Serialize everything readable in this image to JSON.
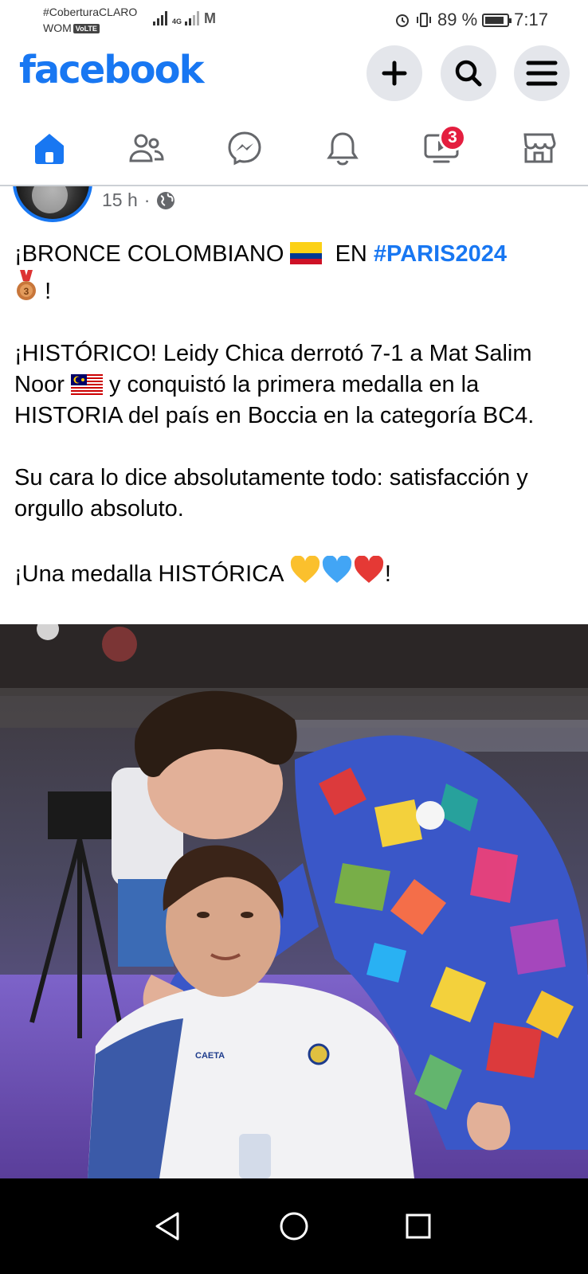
{
  "status_bar": {
    "carrier_1": "#CoberturaCLARO",
    "carrier_2": "WOM",
    "volte": "VoLTE",
    "network": "4G",
    "battery": "89 %",
    "battery_level": 0.89,
    "time": "7:17",
    "icons": [
      "signal-icon",
      "signal-icon",
      "gmail-icon",
      "alarm-icon",
      "vibrate-icon",
      "battery-icon"
    ]
  },
  "header": {
    "logo": "facebook",
    "buttons": [
      "plus-icon",
      "search-icon",
      "menu-icon"
    ]
  },
  "tabs": {
    "items": [
      "home-icon",
      "friends-icon",
      "messenger-icon",
      "notifications-icon",
      "video-icon",
      "marketplace-icon"
    ],
    "active": "home",
    "video_badge": "3"
  },
  "post": {
    "time": "15 h",
    "separator": "·",
    "title_before": "¡BRONCE COLOMBIANO",
    "title_en": "EN",
    "hashtag": "#PARIS2024",
    "title_end": "!",
    "body_1": "¡HISTÓRICO! Leidy Chica derrotó 7-1 a Mat Salim Noor",
    "body_1b": "y conquistó la primera medalla en la HISTORIA del país en Boccia en la categoría BC4.",
    "body_2": "Su cara lo dice absolutamente todo: satisfacción y orgullo absoluto.",
    "body_3": "¡Una medalla HISTÓRICA",
    "body_3_end": "!",
    "emojis": [
      "colombia-flag",
      "bronze-medal",
      "malaysia-flag",
      "yellow-heart",
      "blue-heart",
      "red-heart"
    ]
  },
  "photo": {
    "shirt_text": "CAETA"
  },
  "navbar": {
    "buttons": [
      "back-icon",
      "home-circle-icon",
      "recents-icon"
    ]
  }
}
